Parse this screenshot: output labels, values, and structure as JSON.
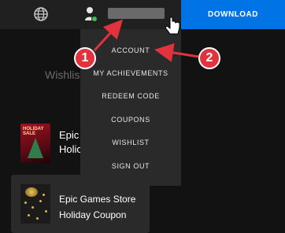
{
  "header": {
    "download_label": "DOWNLOAD"
  },
  "background": {
    "wishlist_partial": "Wishlis"
  },
  "dropdown": {
    "items": [
      {
        "label": "ACCOUNT"
      },
      {
        "label": "MY ACHIEVEMENTS"
      },
      {
        "label": "REDEEM CODE"
      },
      {
        "label": "COUPONS"
      },
      {
        "label": "WISHLIST"
      },
      {
        "label": "SIGN OUT"
      }
    ]
  },
  "cards": [
    {
      "title_line1": "Epic",
      "title_line2": "Holic",
      "thumb_text": "HOLIDAY SALE"
    },
    {
      "title_line1": "Epic Games Store",
      "title_line2": "Holiday Coupon"
    }
  ],
  "annotations": {
    "badge_1": "1",
    "badge_2": "2",
    "color": "#e1333d"
  },
  "colors": {
    "accent": "#0074e4",
    "topbar": "#202020",
    "menu_bg": "#2a2a2a",
    "status_online": "#3ac249"
  },
  "icons": {
    "globe": "globe-icon",
    "user": "user-icon",
    "cursor": "hand-cursor-icon"
  }
}
